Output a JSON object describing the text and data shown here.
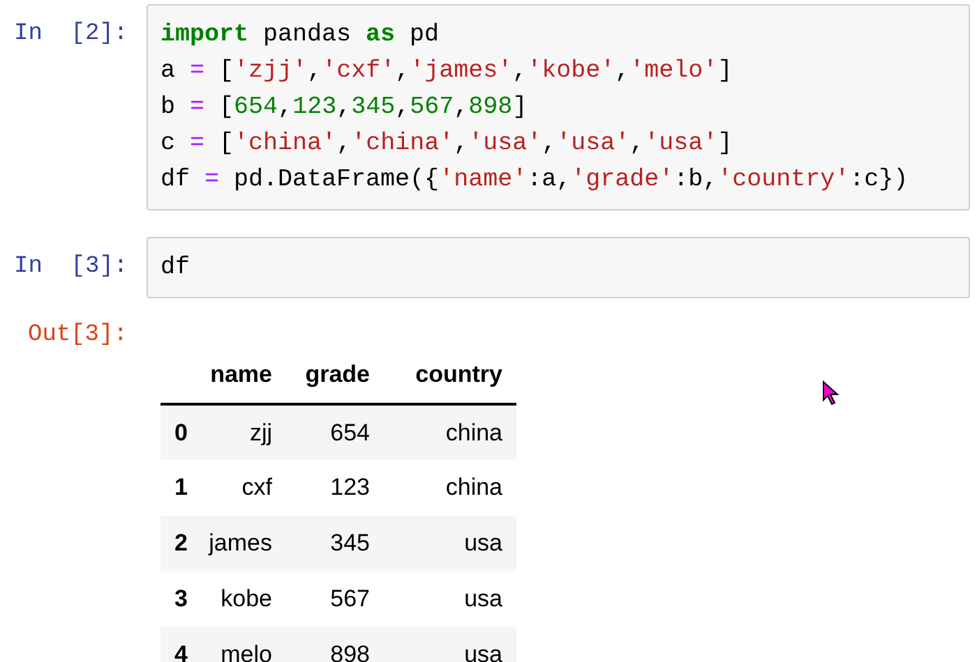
{
  "cells": [
    {
      "prompt": "In  [2]:",
      "code_lines": [
        [
          {
            "text": "import",
            "kind": "keyword"
          },
          {
            "text": " pandas ",
            "kind": "plain"
          },
          {
            "text": "as",
            "kind": "keyword"
          },
          {
            "text": " pd",
            "kind": "plain"
          }
        ],
        [
          {
            "text": "a ",
            "kind": "plain"
          },
          {
            "text": "=",
            "kind": "operator"
          },
          {
            "text": " [",
            "kind": "plain"
          },
          {
            "text": "'zjj'",
            "kind": "string"
          },
          {
            "text": ",",
            "kind": "plain"
          },
          {
            "text": "'cxf'",
            "kind": "string"
          },
          {
            "text": ",",
            "kind": "plain"
          },
          {
            "text": "'james'",
            "kind": "string"
          },
          {
            "text": ",",
            "kind": "plain"
          },
          {
            "text": "'kobe'",
            "kind": "string"
          },
          {
            "text": ",",
            "kind": "plain"
          },
          {
            "text": "'melo'",
            "kind": "string"
          },
          {
            "text": "]",
            "kind": "plain"
          }
        ],
        [
          {
            "text": "b ",
            "kind": "plain"
          },
          {
            "text": "=",
            "kind": "operator"
          },
          {
            "text": " [",
            "kind": "plain"
          },
          {
            "text": "654",
            "kind": "number"
          },
          {
            "text": ",",
            "kind": "plain"
          },
          {
            "text": "123",
            "kind": "number"
          },
          {
            "text": ",",
            "kind": "plain"
          },
          {
            "text": "345",
            "kind": "number"
          },
          {
            "text": ",",
            "kind": "plain"
          },
          {
            "text": "567",
            "kind": "number"
          },
          {
            "text": ",",
            "kind": "plain"
          },
          {
            "text": "898",
            "kind": "number"
          },
          {
            "text": "]",
            "kind": "plain"
          }
        ],
        [
          {
            "text": "c ",
            "kind": "plain"
          },
          {
            "text": "=",
            "kind": "operator"
          },
          {
            "text": " [",
            "kind": "plain"
          },
          {
            "text": "'china'",
            "kind": "string"
          },
          {
            "text": ",",
            "kind": "plain"
          },
          {
            "text": "'china'",
            "kind": "string"
          },
          {
            "text": ",",
            "kind": "plain"
          },
          {
            "text": "'usa'",
            "kind": "string"
          },
          {
            "text": ",",
            "kind": "plain"
          },
          {
            "text": "'usa'",
            "kind": "string"
          },
          {
            "text": ",",
            "kind": "plain"
          },
          {
            "text": "'usa'",
            "kind": "string"
          },
          {
            "text": "]",
            "kind": "plain"
          }
        ],
        [
          {
            "text": "df ",
            "kind": "plain"
          },
          {
            "text": "=",
            "kind": "operator"
          },
          {
            "text": " pd.DataFrame({",
            "kind": "plain"
          },
          {
            "text": "'name'",
            "kind": "string"
          },
          {
            "text": ":a,",
            "kind": "plain"
          },
          {
            "text": "'grade'",
            "kind": "string"
          },
          {
            "text": ":b,",
            "kind": "plain"
          },
          {
            "text": "'country'",
            "kind": "string"
          },
          {
            "text": ":c})",
            "kind": "plain"
          }
        ]
      ]
    },
    {
      "prompt": "In  [3]:",
      "code_lines": [
        [
          {
            "text": "df",
            "kind": "plain"
          }
        ]
      ],
      "output": {
        "prompt": "Out[3]:",
        "table": {
          "columns": [
            "name",
            "grade",
            "country"
          ],
          "rows": [
            {
              "index": "0",
              "cells": [
                "zjj",
                "654",
                "china"
              ]
            },
            {
              "index": "1",
              "cells": [
                "cxf",
                "123",
                "china"
              ]
            },
            {
              "index": "2",
              "cells": [
                "james",
                "345",
                "usa"
              ]
            },
            {
              "index": "3",
              "cells": [
                "kobe",
                "567",
                "usa"
              ]
            },
            {
              "index": "4",
              "cells": [
                "melo",
                "898",
                "usa"
              ]
            }
          ]
        }
      }
    }
  ]
}
